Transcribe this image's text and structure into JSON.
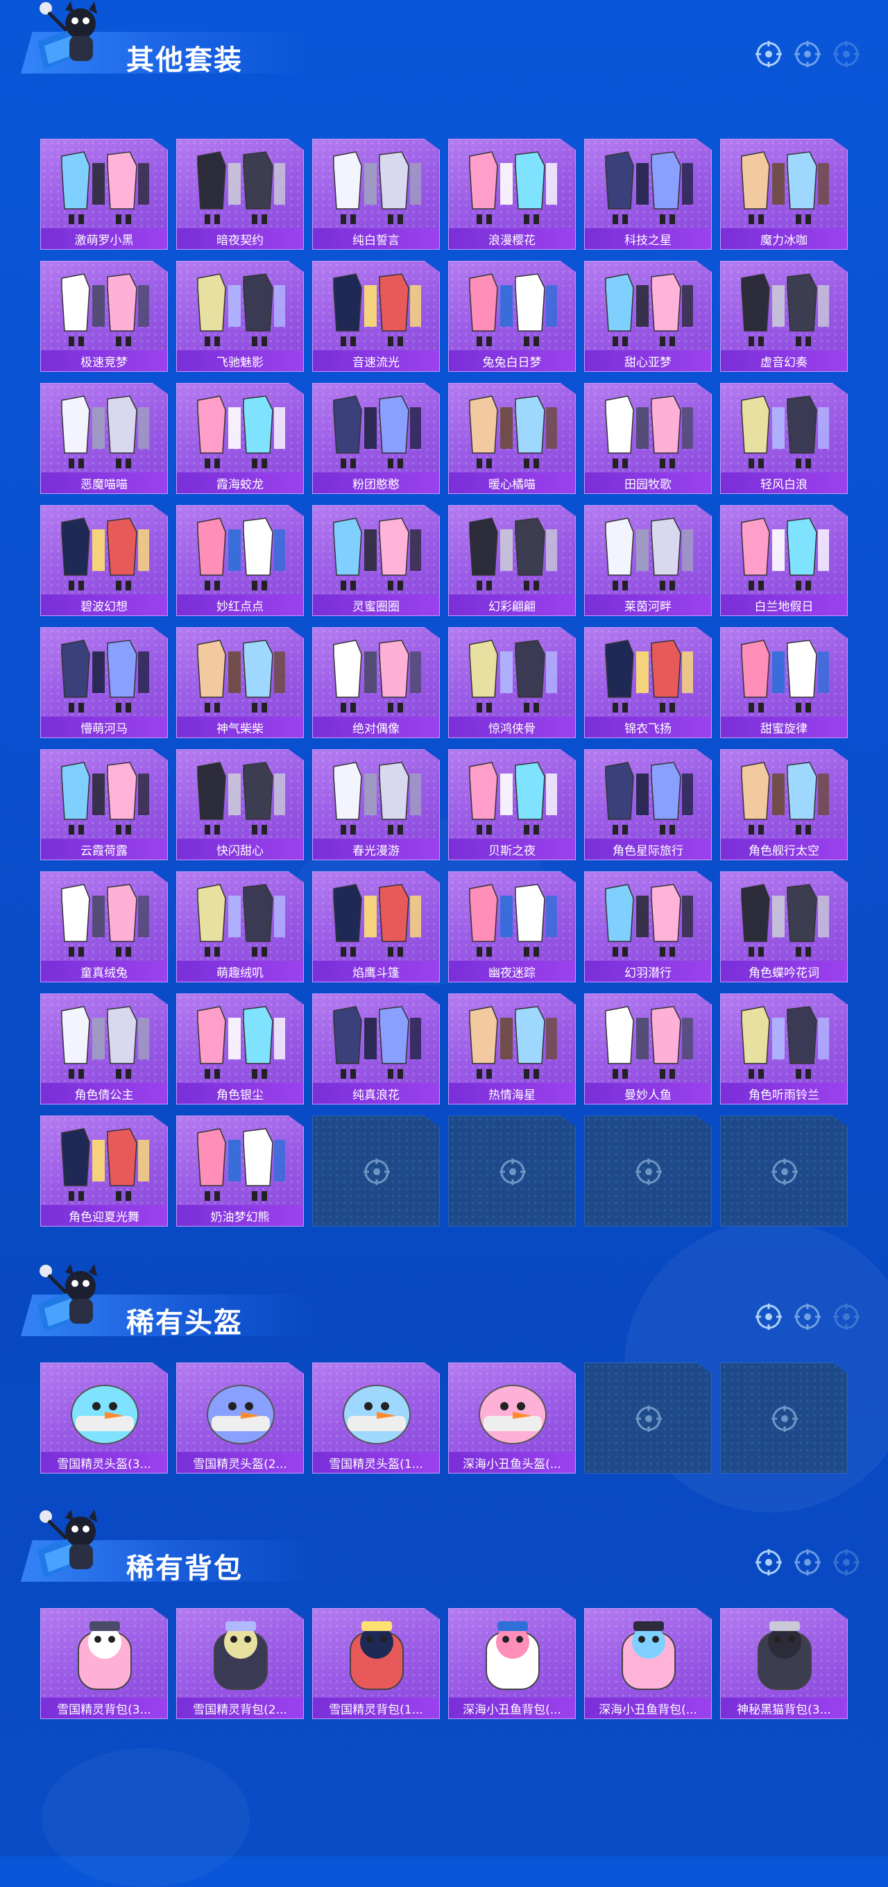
{
  "sections": [
    {
      "title": "其他套装",
      "items": [
        "激萌罗小黑",
        "暗夜契约",
        "纯白誓言",
        "浪漫樱花",
        "科技之星",
        "魔力冰咖",
        "极速竞梦",
        "飞驰魅影",
        "音速流光",
        "兔兔白日梦",
        "甜心亚梦",
        "虚音幻奏",
        "恶魔喵喵",
        "霞海蛟龙",
        "粉团憨憨",
        "暖心橘喵",
        "田园牧歌",
        "轻风白浪",
        "碧波幻想",
        "妙红点点",
        "灵蜜圈圈",
        "幻彩翩翩",
        "莱茵河畔",
        "白兰地假日",
        "懵萌河马",
        "神气柴柴",
        "绝对偶像",
        "惊鸿侠骨",
        "锦衣飞扬",
        "甜蜜旋律",
        "云霞荷露",
        "快闪甜心",
        "春光漫游",
        "贝斯之夜",
        "角色星际旅行",
        "角色舰行太空",
        "童真绒兔",
        "萌趣绒叽",
        "焰鹰斗篷",
        "幽夜迷踪",
        "幻羽潜行",
        "角色蝶吟花词",
        "角色倩公主",
        "角色银尘",
        "纯真浪花",
        "热情海星",
        "曼妙人鱼",
        "角色听雨铃兰",
        "角色迎夏光舞",
        "奶油梦幻熊"
      ],
      "empty_slots": 4
    },
    {
      "title": "稀有头盔",
      "items": [
        "雪国精灵头盔(3...",
        "雪国精灵头盔(2...",
        "雪国精灵头盔(1...",
        "深海小丑鱼头盔(..."
      ],
      "empty_slots": 2
    },
    {
      "title": "稀有背包",
      "items": [
        "雪国精灵背包(3...",
        "雪国精灵背包(2...",
        "雪国精灵背包(1...",
        "深海小丑鱼背包(...",
        "深海小丑鱼背包(...",
        "神秘黑猫背包(3..."
      ],
      "empty_slots": 0
    }
  ],
  "colors": {
    "accent": "#9a5be6",
    "label": "#7a2fd8",
    "empty": "#1e4a8a"
  },
  "icons": {
    "target": "crosshair-icon",
    "mascot": "mascot-icon"
  }
}
